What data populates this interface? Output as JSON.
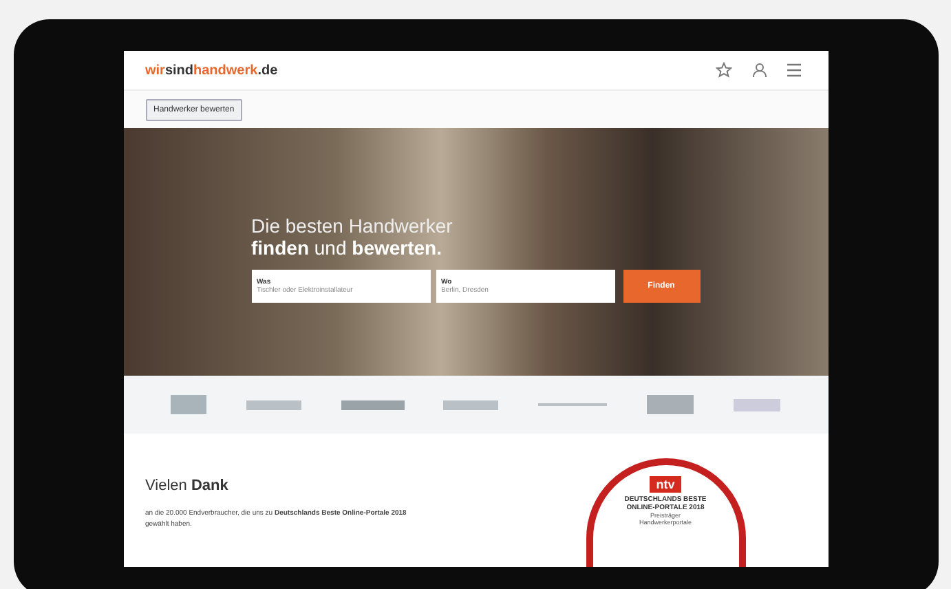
{
  "header": {
    "logo": [
      {
        "text": "wir",
        "accent": true
      },
      {
        "text": "sind",
        "accent": false
      },
      {
        "text": "handwerk",
        "accent": true
      },
      {
        "text": ".de",
        "accent": false
      }
    ]
  },
  "rate_button": "Handwerker bewerten",
  "hero": {
    "headline": "Die besten Handwerker",
    "subline": "**finden** und **bewerten.**",
    "fields": [
      {
        "label": "Was",
        "placeholder": "Tischler oder Elektroinstallateur"
      },
      {
        "label": "Wo",
        "placeholder": "Berlin, Dresden"
      }
    ],
    "search_button": "Finden"
  },
  "thanks": {
    "title": "Vielen **Dank**",
    "text": "an die 20.000 Endverbraucher, die uns zu **Deutschlands Beste Online-Portale 2018** gewählt haben."
  },
  "badge": {
    "logo": "ntv",
    "title": "DEUTSCHLANDS BESTE",
    "subtitle": "ONLINE-PORTALE 2018",
    "caption": "Preisträger",
    "category": "Handwerkerportale"
  }
}
